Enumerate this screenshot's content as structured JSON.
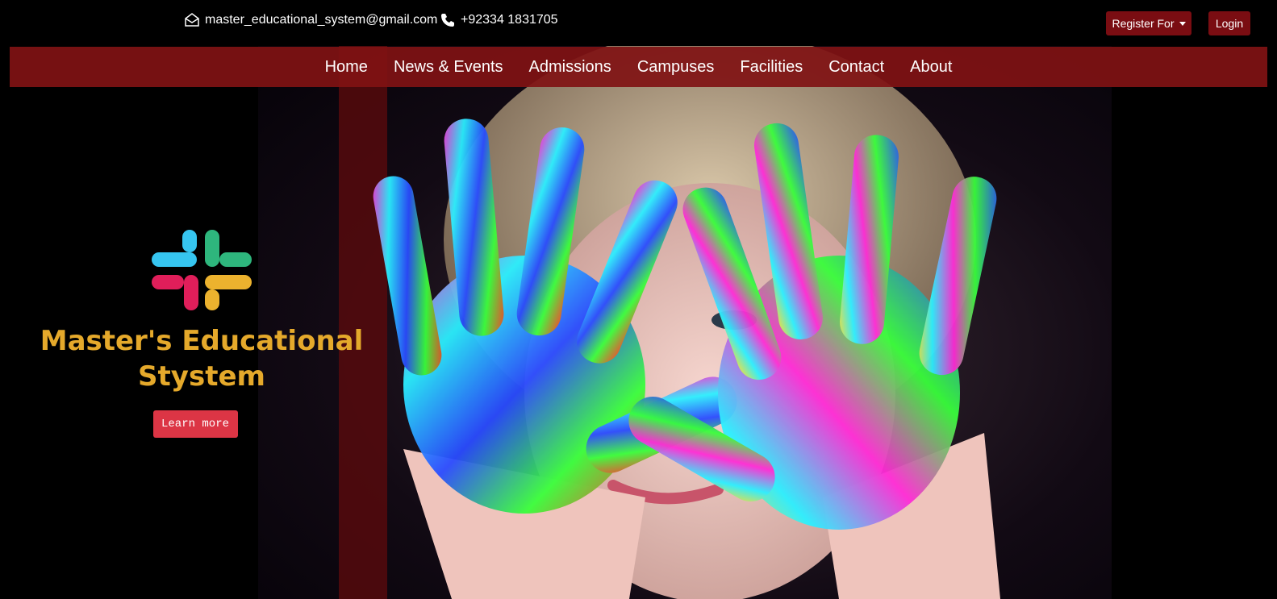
{
  "topbar": {
    "email": "master_educational_system@gmail.com",
    "email_icon": "envelope-icon",
    "phone": "+92334 1831705",
    "phone_icon": "phone-icon",
    "register_label": "Register For",
    "login_label": "Login"
  },
  "nav": {
    "items": [
      {
        "label": "Home"
      },
      {
        "label": "News & Events"
      },
      {
        "label": "Admissions"
      },
      {
        "label": "Campuses"
      },
      {
        "label": "Facilities"
      },
      {
        "label": "Contact"
      },
      {
        "label": "About"
      }
    ]
  },
  "brand": {
    "logo_icon": "slack-style-logo-icon",
    "title": "Master's Educational Stystem",
    "learn_more_label": "Learn more"
  },
  "colors": {
    "nav_bg": "#801214",
    "button_dark_red": "#7a0d12",
    "learn_more_bg": "#dc3545",
    "title_gold": "#e5a92b"
  }
}
